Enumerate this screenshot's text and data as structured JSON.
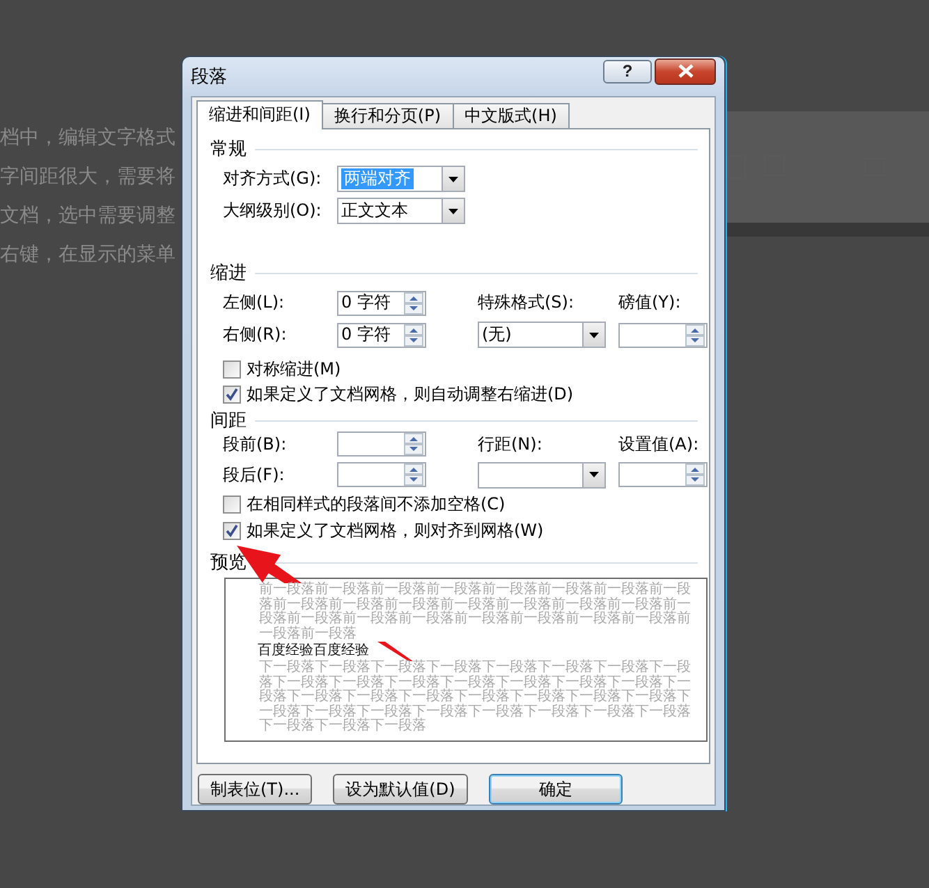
{
  "background_document": {
    "lines": [
      "档中，编辑文字格式",
      "字间距很大，需要将",
      "文档，选中需要调整",
      "右键，在显示的菜单"
    ]
  },
  "dialog": {
    "title": "段落",
    "help": "?"
  },
  "tabs": [
    {
      "label": "缩进和间距(I)",
      "selected": true
    },
    {
      "label": "换行和分页(P)",
      "selected": false
    },
    {
      "label": "中文版式(H)",
      "selected": false
    }
  ],
  "general": {
    "heading": "常规",
    "alignment": {
      "label": "对齐方式(G):",
      "value": "两端对齐",
      "selected": true
    },
    "outline": {
      "label": "大纲级别(O):",
      "value": "正文文本",
      "selected": false
    }
  },
  "indent": {
    "heading": "缩进",
    "left": {
      "label": "左侧(L):",
      "value": "0 字符"
    },
    "right": {
      "label": "右侧(R):",
      "value": "0 字符"
    },
    "special": {
      "label": "特殊格式(S):",
      "value": "(无)"
    },
    "by": {
      "label": "磅值(Y):"
    },
    "checkboxes": [
      {
        "label": "对称缩进(M)",
        "checked": false
      },
      {
        "label": "如果定义了文档网格，则自动调整右缩进(D)",
        "checked": true
      }
    ]
  },
  "spacing": {
    "heading": "间距",
    "before": {
      "label": "段前(B):"
    },
    "after": {
      "label": "段后(F):"
    },
    "line_spacing": {
      "label": "行距(N):"
    },
    "at": {
      "label": "设置值(A):"
    },
    "checkboxes": [
      {
        "label": "在相同样式的段落间不添加空格(C)",
        "checked": false
      },
      {
        "label": "如果定义了文档网格，则对齐到网格(W)",
        "checked": true
      }
    ]
  },
  "preview": {
    "heading": "预览",
    "previous": "前一段落前一段落前一段落前一段落前一段落前一段落前一段落前一段落前一段落前一段落前一段落前一段落前一段落前一段落前一段落前一段落前一段落前一段落前一段落前一段落前一段落前一段落前一段落前一段落前一段落",
    "sample": "百度经验百度经验",
    "next": "下一段落下一段落下一段落下一段落下一段落下一段落下一段落下一段落下一段落下一段落下一段落下一段落下一段落下一段落下一段落下一段落下一段落下一段落下一段落下一段落下一段落下一段落下一段落下一段落下一段落下一段落下一段落下一段落下一段落下一段落下一段落下一段落下一段落下一段落"
  },
  "buttons": [
    "制表位(T)...",
    "设为默认值(D)",
    "确定"
  ]
}
